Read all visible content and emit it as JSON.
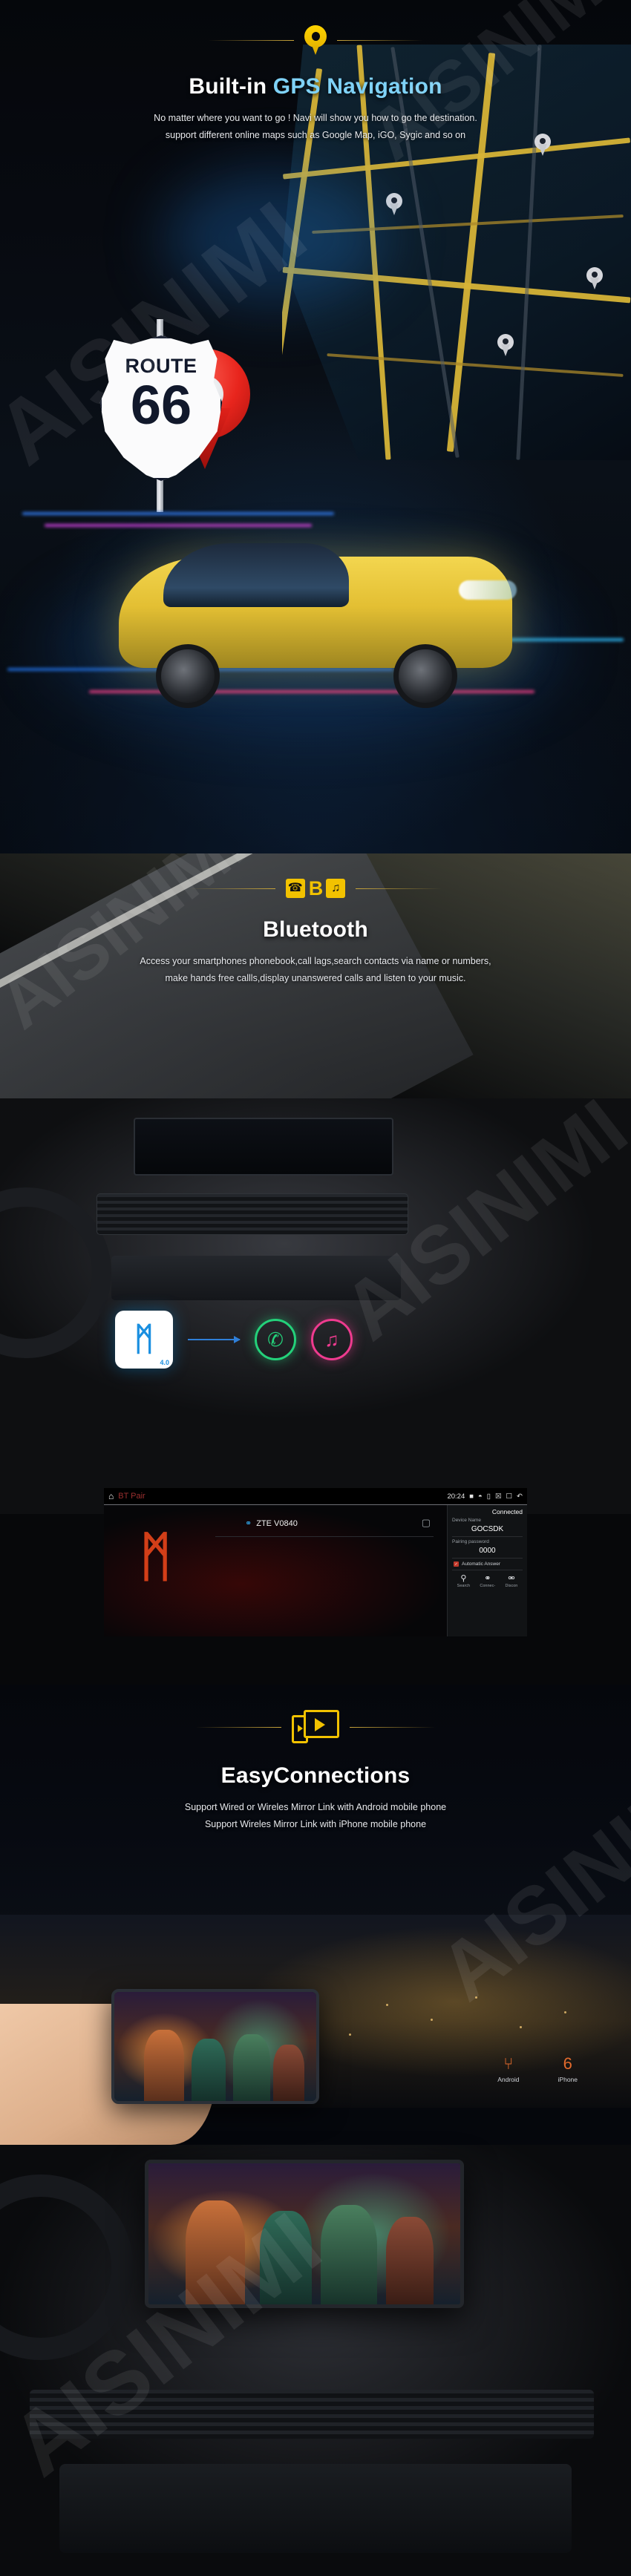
{
  "sections": [
    {
      "id": "gps",
      "icon_name": "location-pin-icon",
      "title_white": "Built-in ",
      "title_accent": "GPS Navigation",
      "subtitle_line1": "No matter where you want to go ! Navi  will show you how to go the destination.",
      "subtitle_line2": "support different online maps such as Google Map, iGO, Sygic and so on",
      "sign": {
        "top_text": "ROUTE",
        "number": "66"
      }
    },
    {
      "id": "bluetooth",
      "icons": [
        "phone-icon",
        "bluetooth-icon",
        "music-note-icon"
      ],
      "phone_glyph": "☎",
      "bluetooth_glyph": "B",
      "music_glyph": "♫",
      "title": "Bluetooth",
      "subtitle_line1": "Access your smartphones phonebook,call lags,search contacts via name or numbers,",
      "subtitle_line2": "make hands free callls,display unanswered calls and listen to your music.",
      "flow": {
        "badge_glyph": "ᛗ",
        "badge_version": "4.0",
        "call_glyph": "✆",
        "music_glyph": "♫"
      },
      "screen": {
        "home_glyph": "⌂",
        "title": "BT Pair",
        "time": "20:24",
        "status_icons": [
          "battery-icon",
          "wifi-icon",
          "phone-icon",
          "close-box-icon",
          "window-icon",
          "back-icon"
        ],
        "device_row": {
          "link_glyph": "⚭",
          "name": "ZTE V0840",
          "delete_glyph": "Ὕ1"
        },
        "bt_glyph": "ᛗ",
        "panel": {
          "status": "Connected",
          "device_name_label": "Device Name",
          "device_name_value": "GOCSDK",
          "pairing_label": "Pairing password",
          "pairing_value": "0000",
          "auto_answer_label": "Automatic Answer",
          "auto_answer_checked": true,
          "buttons": [
            {
              "icon": "search-icon",
              "glyph": "⚲",
              "label": "Search"
            },
            {
              "icon": "connect-icon",
              "glyph": "⚭",
              "label": "Connec-"
            },
            {
              "icon": "disconnect-icon",
              "glyph": "⚮",
              "label": "Discon"
            }
          ]
        }
      }
    },
    {
      "id": "easyconnections",
      "icon_name": "mirror-link-icon",
      "title": "EasyConnections",
      "subtitle_line1": "Support Wired or Wireles Mirror Link with Android mobile phone",
      "subtitle_line2": "Support Wireles Mirror Link with iPhone mobile phone",
      "mini_icons": [
        {
          "icon": "usb-icon",
          "glyph": "⑂",
          "label": "Android"
        },
        {
          "icon": "wifi-icon",
          "glyph": "὏6",
          "label": "iPhone"
        }
      ]
    }
  ],
  "watermark": "AISINIMI",
  "colors": {
    "accent_blue": "#7fd2f7",
    "accent_yellow": "#f2c200",
    "bt_blue": "#1a8fe0",
    "green": "#24d17a",
    "pink": "#ef3b8f",
    "red": "#e3431a"
  }
}
